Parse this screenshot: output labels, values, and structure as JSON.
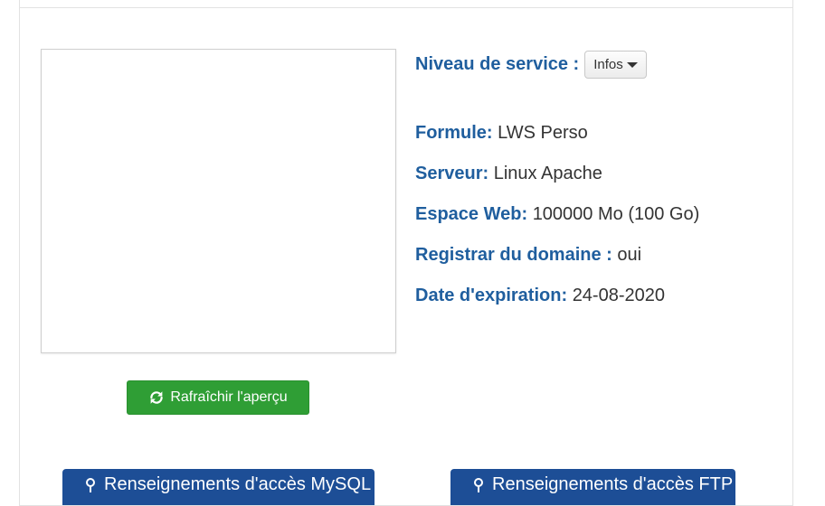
{
  "service_level": {
    "label": "Niveau de service :",
    "dropdown_label": "Infos"
  },
  "details": [
    {
      "label": "Formule:",
      "value": "LWS Perso"
    },
    {
      "label": "Serveur:",
      "value": "Linux Apache"
    },
    {
      "label": "Espace Web:",
      "value": "100000 Mo (100 Go)"
    },
    {
      "label": "Registrar du domaine :",
      "value": "oui"
    },
    {
      "label": "Date d'expiration:",
      "value": "24-08-2020"
    }
  ],
  "preview": {
    "refresh_label": "Rafraîchir l'aperçu",
    "refresh_icon": "refresh-icon"
  },
  "bottom_buttons": [
    {
      "label": "Renseignements d'accès MySQL",
      "icon": "key-icon"
    },
    {
      "label": "Renseignements d'accès FTP",
      "icon": "key-icon"
    }
  ],
  "colors": {
    "label_blue": "#1f5e9e",
    "refresh_green": "#2f9e35",
    "bottom_button_blue": "#1d4e96"
  }
}
